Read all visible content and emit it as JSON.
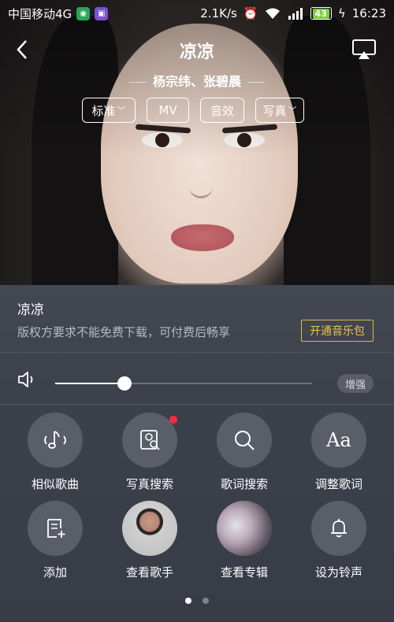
{
  "status_bar": {
    "carrier": "中国移动4G",
    "speed": "2.1K/s",
    "battery": "43",
    "time": "16:23"
  },
  "player": {
    "title": "凉凉",
    "artist": "杨宗纬、张碧晨",
    "chips": [
      {
        "label": "标准",
        "has_dropdown": true
      },
      {
        "label": "MV",
        "has_dropdown": false
      },
      {
        "label": "音效",
        "has_dropdown": false
      },
      {
        "label": "写真",
        "has_dropdown": true
      }
    ]
  },
  "song_info": {
    "name": "凉凉",
    "notice": "版权方要求不能免费下载，可付费后畅享",
    "package_button": "开通音乐包"
  },
  "volume": {
    "level": 0.27,
    "boost_label": "增强"
  },
  "actions": [
    {
      "label": "相似歌曲",
      "icon": "similar-songs-icon"
    },
    {
      "label": "写真搜索",
      "icon": "photo-search-icon",
      "badge": true
    },
    {
      "label": "歌词搜索",
      "icon": "search-icon"
    },
    {
      "label": "调整歌词",
      "icon": "font-adjust-icon"
    },
    {
      "label": "添加",
      "icon": "add-to-list-icon"
    },
    {
      "label": "查看歌手",
      "icon": "singer-avatar"
    },
    {
      "label": "查看专辑",
      "icon": "album-cover"
    },
    {
      "label": "设为铃声",
      "icon": "bell-icon"
    }
  ],
  "pager": {
    "count": 2,
    "active": 0
  },
  "colors": {
    "accent_gold": "#e8c24e",
    "panel_bg": "#3d414c",
    "badge_red": "#ff2a3d",
    "battery_green": "#7ecf3a"
  }
}
